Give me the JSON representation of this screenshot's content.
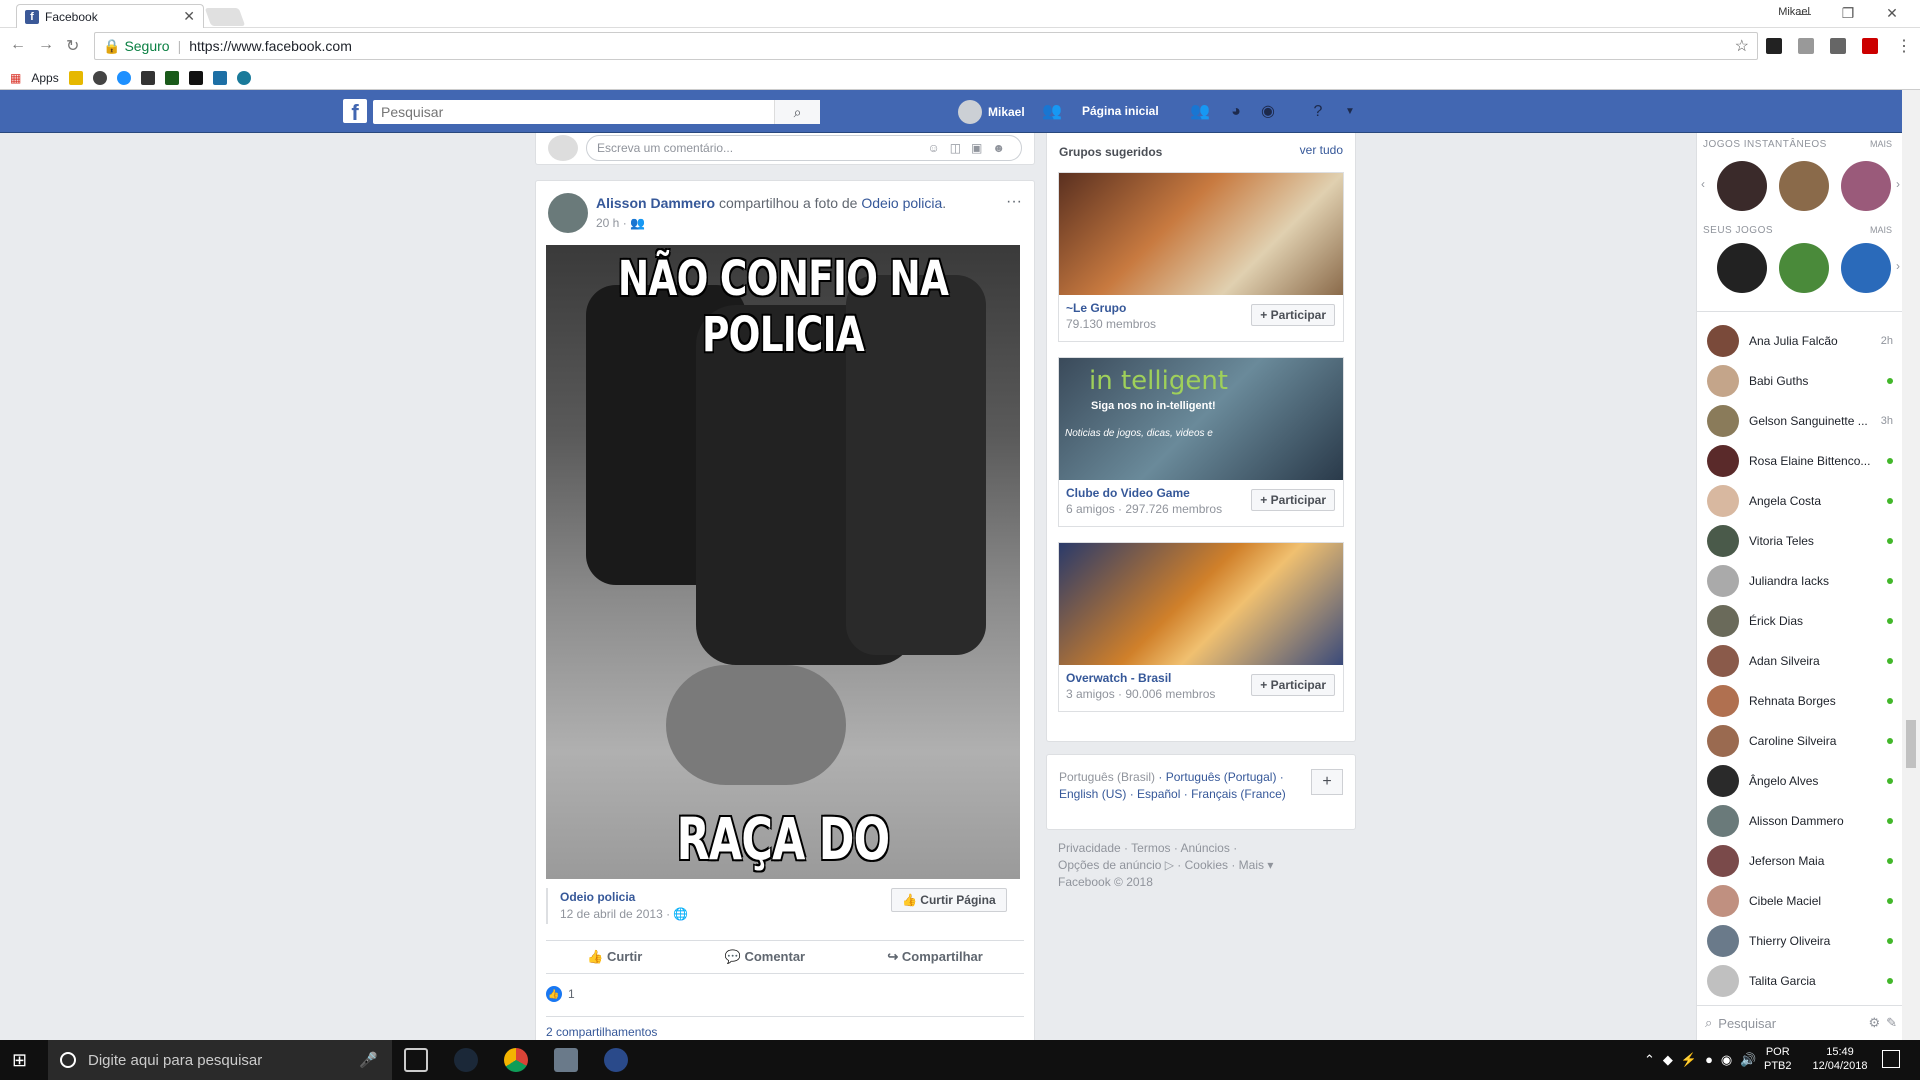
{
  "browser": {
    "tab_title": "Facebook",
    "user_badge": "Mikael",
    "security_label": "Seguro",
    "url": "https://www.facebook.com",
    "bookmarks_apps": "Apps"
  },
  "fb_header": {
    "search_placeholder": "Pesquisar",
    "user_name": "Mikael",
    "home_label": "Página inicial"
  },
  "comment_box": {
    "placeholder": "Escreva um comentário..."
  },
  "post": {
    "author": "Alisson Dammero",
    "action": "compartilhou a foto de",
    "source_page": "Odeio policia",
    "time": "20 h",
    "image_top_text": "NÃO CONFIO NA POLICIA",
    "image_bottom_text": "RAÇA DO CARALHO!",
    "shared_page": "Odeio policia",
    "shared_date": "12 de abril de 2013",
    "like_page_label": "Curtir Página",
    "like_label": "Curtir",
    "comment_label": "Comentar",
    "share_label": "Compartilhar",
    "reaction_count": "1",
    "shares": "2 compartilhamentos"
  },
  "suggested_groups": {
    "title": "Grupos sugeridos",
    "see_all": "ver tudo",
    "join_label": "+ Participar",
    "groups": [
      {
        "name": "~Le Grupo",
        "members": "79.130 membros"
      },
      {
        "name": "Clube do Video Game",
        "members": "6 amigos · 297.726 membros",
        "image_text": "in telligent",
        "image_sub": "Siga nos no in-telligent!",
        "image_sub2": "Noticias de jogos, dicas, videos e"
      },
      {
        "name": "Overwatch - Brasil",
        "members": "3 amigos · 90.006 membros"
      }
    ]
  },
  "languages": {
    "current": "Português (Brasil)",
    "others": [
      "Português (Portugal)",
      "English (US)",
      "Español",
      "Français (France)"
    ]
  },
  "footer": {
    "line1": "Privacidade · Termos · Anúncios ·",
    "line2": "Opções de anúncio ▷ · Cookies · Mais ▾",
    "line3": "Facebook © 2018"
  },
  "chat": {
    "instant_games": "JOGOS INSTANTÂNEOS",
    "your_games": "SEUS JOGOS",
    "more": "MAIS",
    "search_placeholder": "Pesquisar",
    "friends": [
      {
        "name": "Ana Julia Falcão",
        "status": "2h",
        "color": "#7a4a3a"
      },
      {
        "name": "Babi Guths",
        "status": "online",
        "color": "#c4a58a"
      },
      {
        "name": "Gelson Sanguinette ...",
        "status": "3h",
        "color": "#8a7b5a"
      },
      {
        "name": "Rosa Elaine Bittenco...",
        "status": "online",
        "color": "#5a2a2a"
      },
      {
        "name": "Angela Costa",
        "status": "online",
        "color": "#d8b8a0"
      },
      {
        "name": "Vitoria Teles",
        "status": "online",
        "color": "#4a5a4a"
      },
      {
        "name": "Juliandra Iacks",
        "status": "online",
        "color": "#aaaaaa"
      },
      {
        "name": "Érick Dias",
        "status": "online",
        "color": "#6a6a5a"
      },
      {
        "name": "Adan Silveira",
        "status": "online",
        "color": "#8a5a4a"
      },
      {
        "name": "Rehnata Borges",
        "status": "online",
        "color": "#b07050"
      },
      {
        "name": "Caroline Silveira",
        "status": "online",
        "color": "#9a6a50"
      },
      {
        "name": "Ângelo Alves",
        "status": "online",
        "color": "#2a2a2a"
      },
      {
        "name": "Alisson Dammero",
        "status": "online",
        "color": "#6a7a7a"
      },
      {
        "name": "Jeferson Maia",
        "status": "online",
        "color": "#7a4a4a"
      },
      {
        "name": "Cibele Maciel",
        "status": "online",
        "color": "#c09080"
      },
      {
        "name": "Thierry Oliveira",
        "status": "online",
        "color": "#6a7a8a"
      },
      {
        "name": "Talita Garcia",
        "status": "online",
        "color": "#c0c0c0"
      }
    ]
  },
  "taskbar": {
    "search_placeholder": "Digite aqui para pesquisar",
    "lang": "POR",
    "layout": "PTB2",
    "time": "15:49",
    "date": "12/04/2018"
  }
}
